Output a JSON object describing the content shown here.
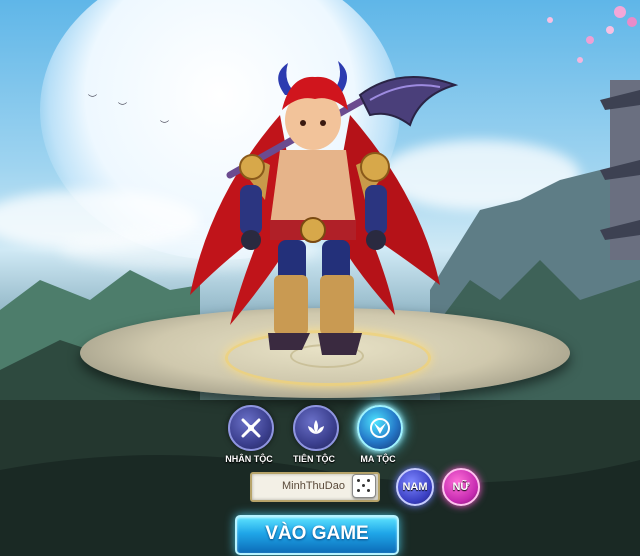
{
  "scene": {
    "moon_color": "#eef8ff",
    "accent_blue": "#2478c8",
    "accent_pink": "#c52ab0"
  },
  "character": {
    "icon": "horned-warrior-hero"
  },
  "races": [
    {
      "label": "NHÂN TỘC",
      "icon": "swords-icon",
      "selected": false
    },
    {
      "label": "TIÊN TỘC",
      "icon": "lotus-icon",
      "selected": false
    },
    {
      "label": "MA TỘC",
      "icon": "demon-emblem-icon",
      "selected": true
    }
  ],
  "name_field": {
    "value": "MinhThuDao",
    "random_icon": "dice-icon"
  },
  "gender": {
    "male_label": "NAM",
    "female_label": "NỮ"
  },
  "play_button": {
    "label": "VÀO GAME"
  }
}
